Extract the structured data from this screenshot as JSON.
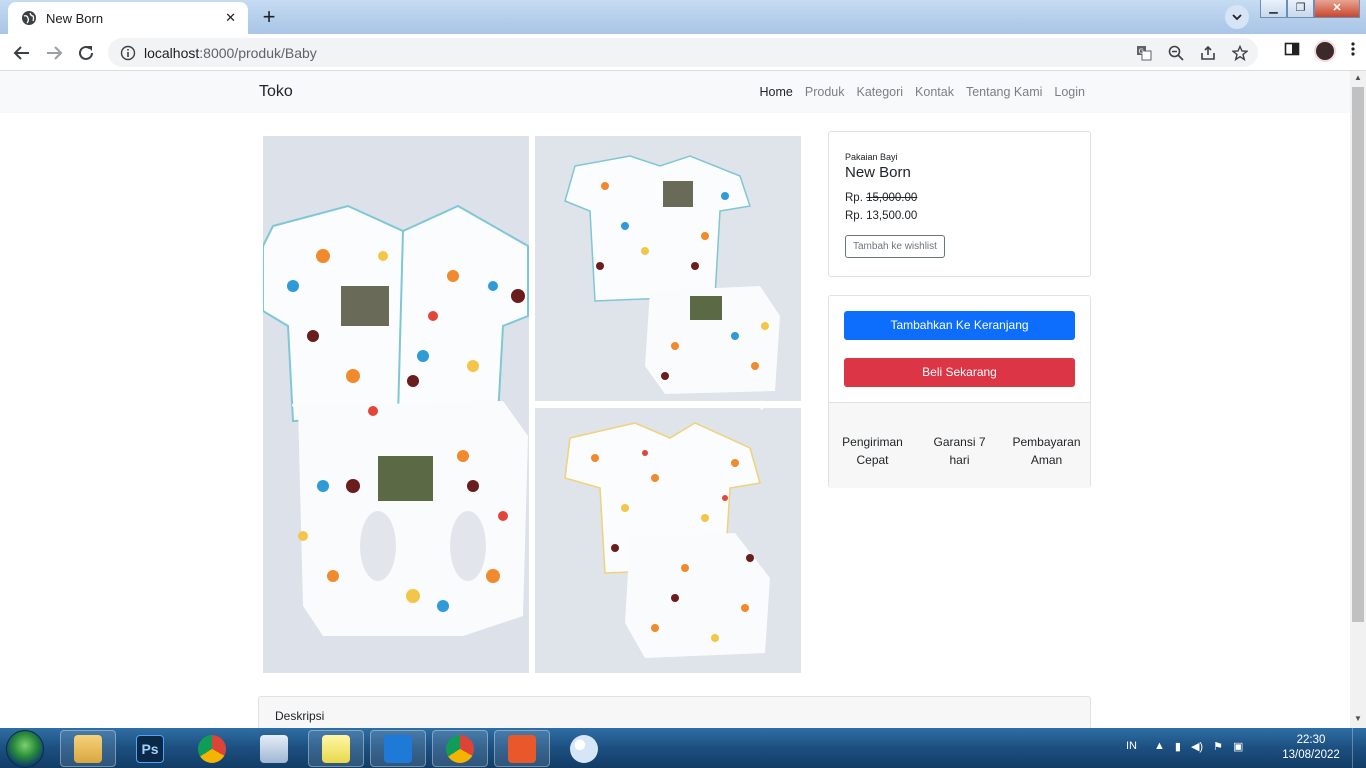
{
  "browser": {
    "tab_title": "New Born",
    "url_host": "localhost",
    "url_rest": ":8000/produk/Baby"
  },
  "navbar": {
    "brand": "Toko",
    "links": [
      "Home",
      "Produk",
      "Kategori",
      "Kontak",
      "Tentang Kami",
      "Login"
    ],
    "active": "Home"
  },
  "product": {
    "category": "Pakaian Bayi",
    "name": "New Born",
    "price_prefix": "Rp.",
    "old_price": "15,000.00",
    "new_price": "Rp. 13,500.00",
    "wishlist_label": "Tambah ke wishlist"
  },
  "actions": {
    "cart_label": "Tambahkan Ke Keranjang",
    "buy_label": "Beli Sekarang",
    "features": [
      "Pengiriman Cepat",
      "Garansi 7 hari",
      "Pembayaran Aman"
    ]
  },
  "description": {
    "title": "Deskripsi"
  },
  "taskbar": {
    "language": "IN",
    "time": "22:30",
    "date": "13/08/2022"
  },
  "colors": {
    "primary": "#0d6efd",
    "danger": "#dc3545",
    "navbar_bg": "#f8f9fa"
  }
}
